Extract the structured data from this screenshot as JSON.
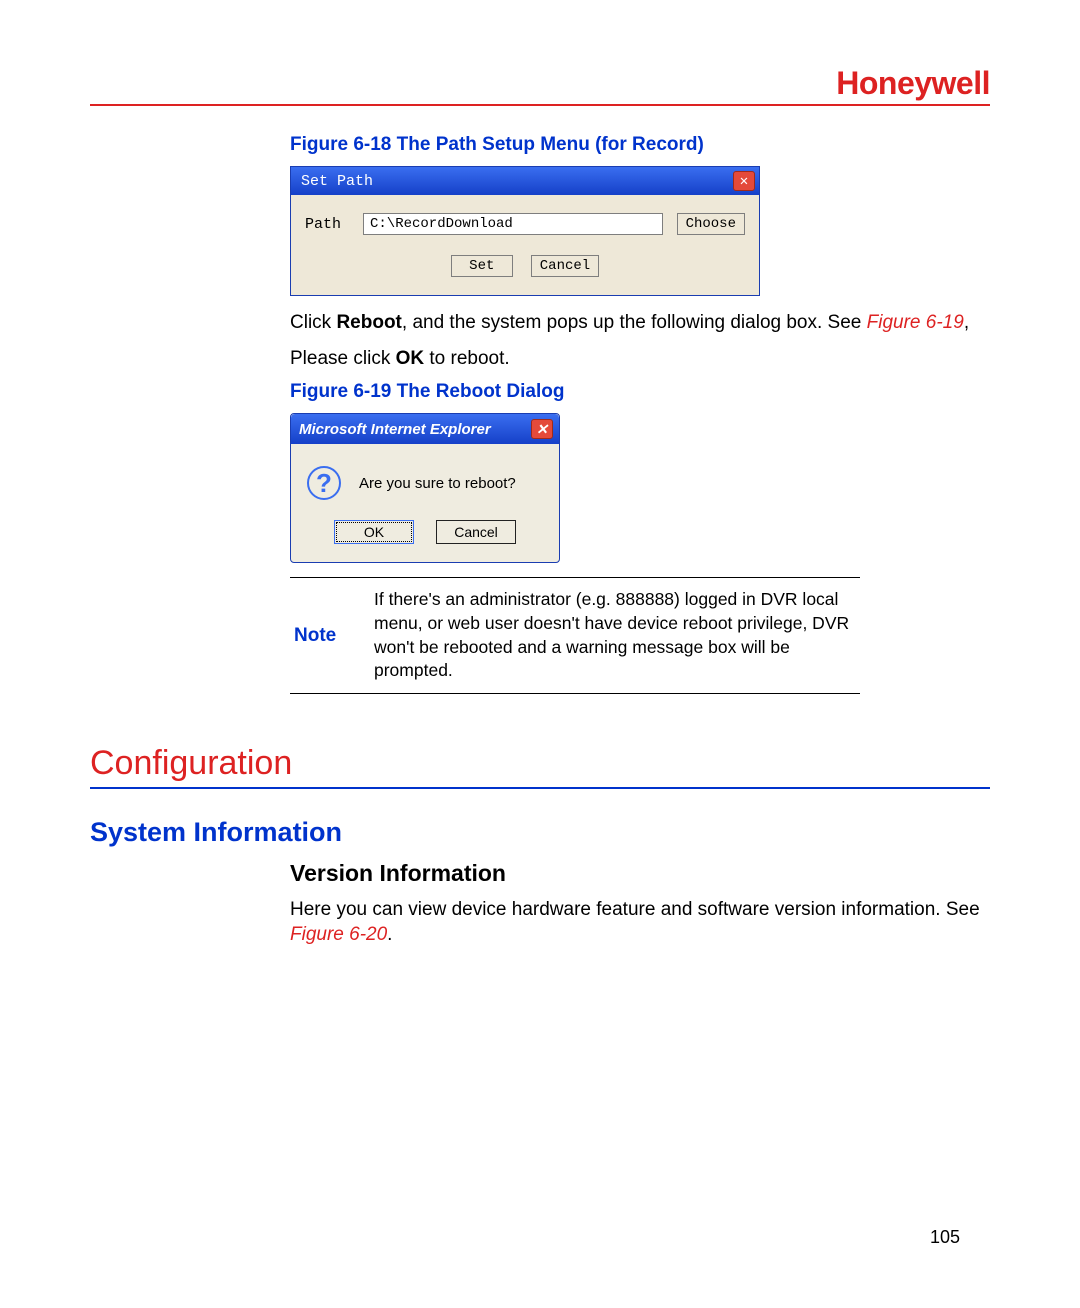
{
  "brand": "Honeywell",
  "figure618_caption": "Figure 6-18 The Path Setup Menu (for Record)",
  "setpath": {
    "title": "Set Path",
    "path_label": "Path",
    "path_value": "C:\\RecordDownload",
    "choose_btn": "Choose",
    "set_btn": "Set",
    "cancel_btn": "Cancel"
  },
  "para1_before": "Click ",
  "para1_bold": "Reboot",
  "para1_mid": ", and the system pops up the following dialog box. See ",
  "para1_figref": "Figure 6-19",
  "para1_after": ",",
  "para2_before": "Please click ",
  "para2_bold": "OK",
  "para2_after": " to reboot.",
  "figure619_caption": "Figure 6-19 The Reboot Dialog",
  "reboot": {
    "title": "Microsoft Internet Explorer",
    "question_mark": "?",
    "message": "Are you sure to reboot?",
    "ok_btn": "OK",
    "cancel_btn": "Cancel"
  },
  "note": {
    "label": "Note",
    "text": "If there's an administrator (e.g. 888888) logged in DVR local menu, or web user doesn't have device reboot privilege, DVR won't be rebooted and a warning message box will be prompted."
  },
  "h1": "Configuration",
  "h2": "System Information",
  "h3": "Version Information",
  "para3_before": "Here you can view device hardware feature and software version information. See ",
  "para3_figref": "Figure 6-20",
  "para3_after": ".",
  "page_number": "105",
  "close_x": "✕"
}
